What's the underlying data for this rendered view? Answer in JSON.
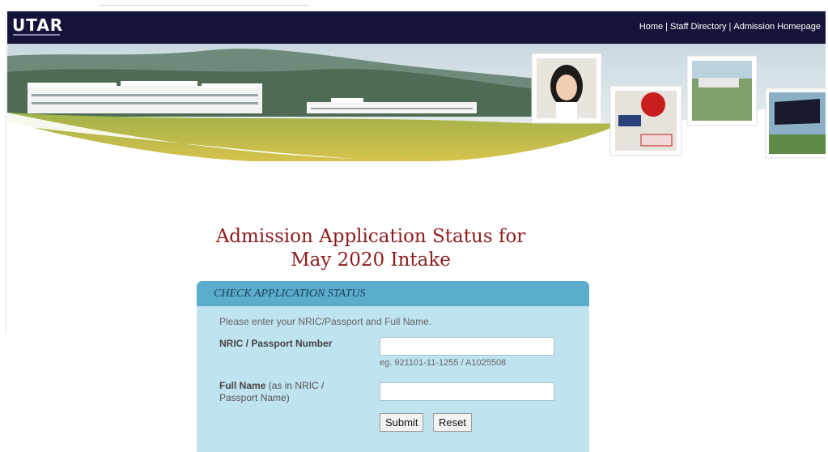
{
  "header": {
    "logo_text": "UTAR",
    "nav": [
      {
        "label": "Home"
      },
      {
        "label": "Staff Directory"
      },
      {
        "label": "Admission Homepage"
      }
    ],
    "separator": "|",
    "background": "#14143a"
  },
  "page": {
    "title_line1": "Admission Application Status for",
    "title_line2": "May 2020 Intake",
    "title_color": "#8e1b1b"
  },
  "panel": {
    "heading": "CHECK APPLICATION STATUS",
    "intro": "Please enter your NRIC/Passport and Full Name.",
    "nric_label": "NRIC / Passport Number",
    "nric_value": "",
    "nric_hint": "eg. 921101-11-1255 / A1025508",
    "name_label_bold": "Full Name",
    "name_label_rest": " (as in NRIC / Passport Name)",
    "name_value": "",
    "submit_label": "Submit",
    "reset_label": "Reset",
    "background": "#bfe3ef",
    "header_background": "#5aaecb"
  }
}
